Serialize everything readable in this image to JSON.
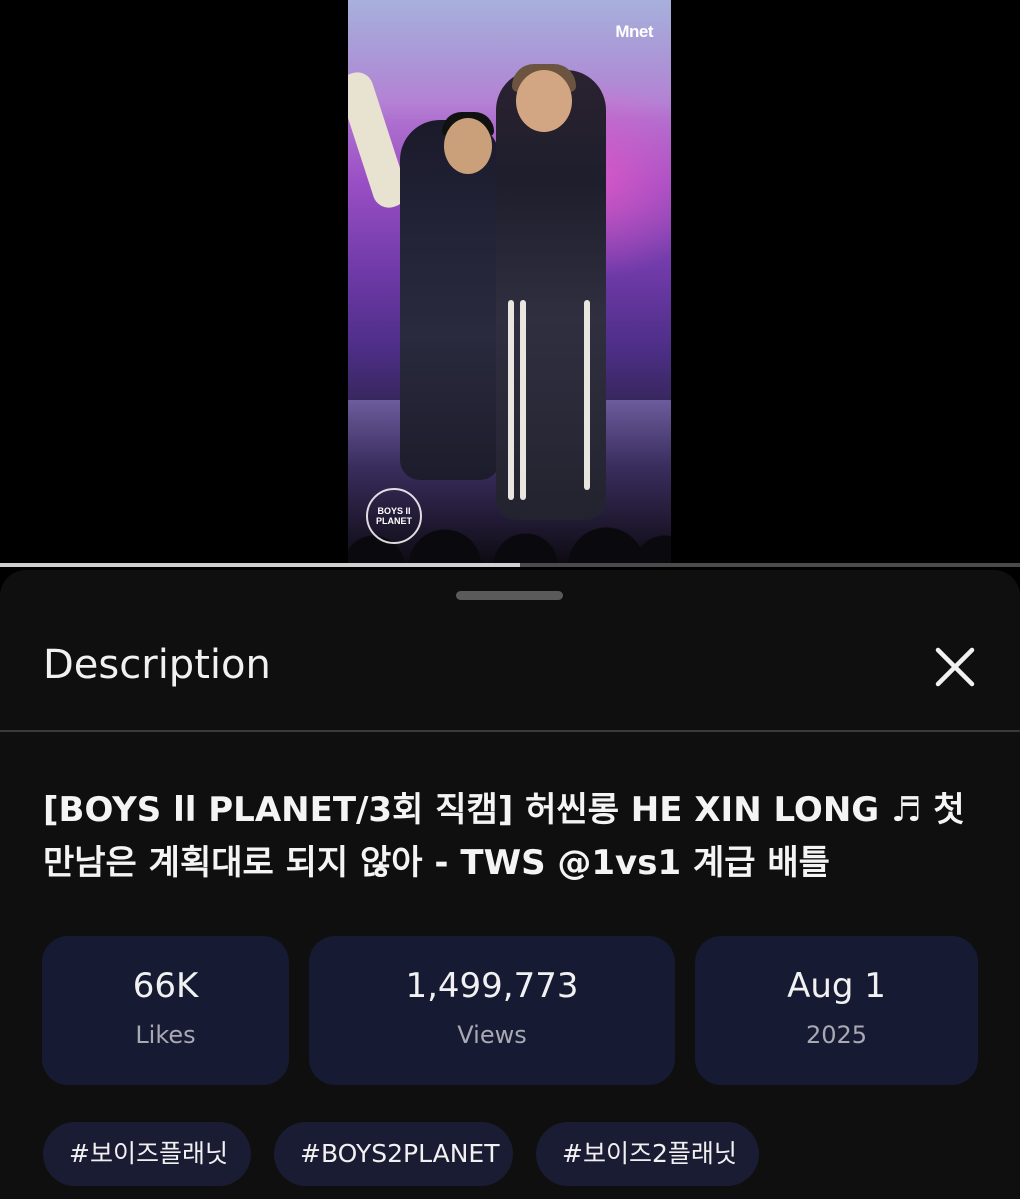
{
  "video": {
    "watermark_logo": "Mnet",
    "show_logo": "BOYS II PLANET",
    "progress_fraction": 0.51
  },
  "description_panel": {
    "title": "Description",
    "close_icon": "close-icon",
    "video_title": "[BOYS ll PLANET/3회 직캠] 허씬롱 HE XIN LONG ♬ 첫 만남은 계획대로 되지 않아 - TWS @1vs1 계급 배틀",
    "stats": {
      "likes_value": "66K",
      "likes_label": "Likes",
      "views_value": "1,499,773",
      "views_label": "Views",
      "date_value": "Aug 1",
      "date_year": "2025"
    },
    "tags": [
      "#보이즈플래닛",
      "#BOYS2PLANET",
      "#보이즈2플래닛"
    ]
  },
  "colors": {
    "panel_background": "#0f0f0f",
    "stat_card_background": "#161a33",
    "tag_chip_background": "#1a1c33",
    "secondary_text": "#a9a9b4"
  }
}
